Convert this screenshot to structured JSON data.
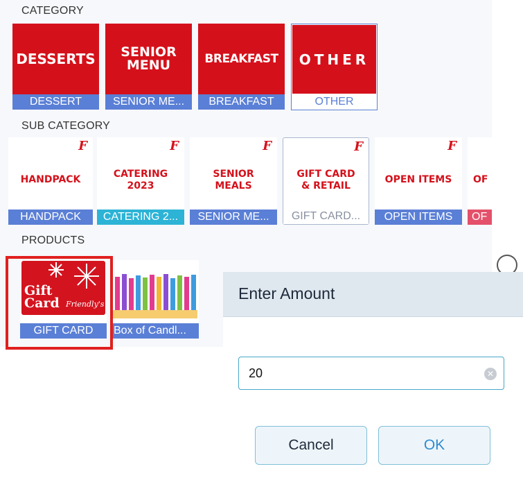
{
  "sections": {
    "category": "CATEGORY",
    "sub_category": "SUB CATEGORY",
    "products": "PRODUCTS"
  },
  "categories": [
    {
      "art": "DESSERTS",
      "label": "DESSERT"
    },
    {
      "art": "SENIOR MENU",
      "label": "SENIOR ME..."
    },
    {
      "art": "BREAKFAST",
      "label": "BREAKFAST"
    },
    {
      "art": "OTHER",
      "label": "OTHER"
    }
  ],
  "sub_categories": [
    {
      "art": "HANDPACK",
      "label": "HANDPACK",
      "logo": "F",
      "color": "#5a7fd6"
    },
    {
      "art": "CATERING 2023",
      "label": "CATERING 2...",
      "logo": "F",
      "color": "#2cb3d6"
    },
    {
      "art": "SENIOR MEALS",
      "label": "SENIOR ME...",
      "logo": "F",
      "color": "#5a7fd6"
    },
    {
      "art": "GIFT CARD & RETAIL",
      "label": "GIFT CARD...",
      "logo": "F",
      "color": "#ffffff"
    },
    {
      "art": "OPEN ITEMS",
      "label": "OPEN ITEMS",
      "logo": "F",
      "color": "#5a7fd6"
    },
    {
      "art": "OF & R",
      "label": "OF",
      "logo": "",
      "color": "#e4506a"
    }
  ],
  "products": [
    {
      "art": "Gift Card",
      "brand": "Friendly's",
      "label": "GIFT CARD"
    },
    {
      "art": "",
      "label": "Box of Candl..."
    }
  ],
  "dialog": {
    "title": "Enter Amount",
    "amount": "20",
    "cancel_label": "Cancel",
    "ok_label": "OK"
  },
  "colors": {
    "brand_red": "#d4111b",
    "caption_blue": "#5a7fd6",
    "highlight": "#e0201f"
  }
}
